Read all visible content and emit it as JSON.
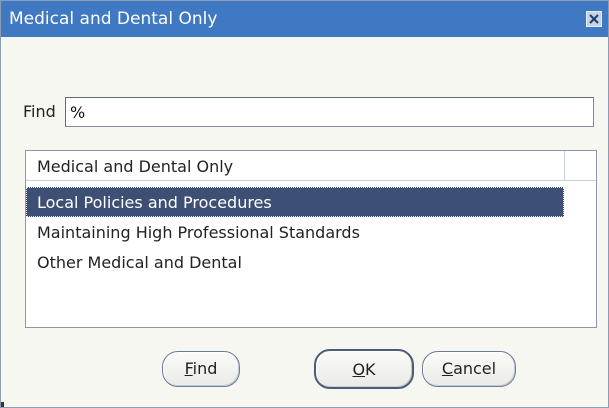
{
  "window": {
    "title": "Medical and Dental Only",
    "close_icon": "close-icon"
  },
  "find": {
    "label": "Find",
    "value": "%"
  },
  "list": {
    "header": "Medical and Dental Only",
    "items": [
      "Local Policies and Procedures",
      "Maintaining High Professional Standards",
      "Other Medical and Dental"
    ],
    "selected_index": 0
  },
  "buttons": {
    "find_mnemonic": "F",
    "find_rest": "ind",
    "ok_mnemonic": "O",
    "ok_rest": "K",
    "cancel_mnemonic": "C",
    "cancel_rest": "ancel"
  },
  "colors": {
    "titlebar": "#3f78c3",
    "selection": "#3d4f75",
    "dialog_bg": "#f7f7f2"
  }
}
